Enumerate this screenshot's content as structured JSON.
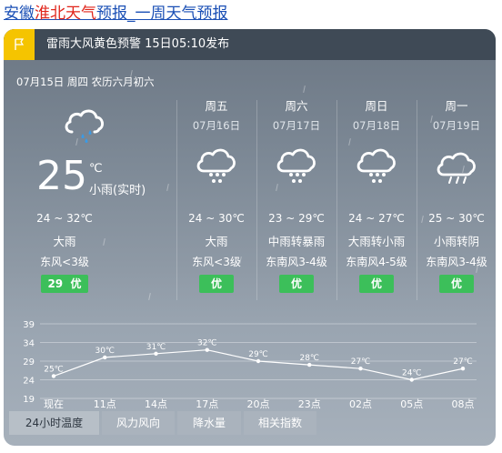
{
  "header": {
    "title_prefix": "安徽",
    "title_red": "淮北天气",
    "title_suffix": "预报_一周天气预报"
  },
  "alert": {
    "text": "雷雨大风黄色预警 15日05:10发布",
    "badge_color": "#f5c400",
    "icon": "warning-flag-icon"
  },
  "today": {
    "date_line": "07月15日 周四 农历六月初六",
    "temp": "25",
    "unit": "℃",
    "realtime_desc": "小雨(实时)",
    "range": "24 ~ 32℃",
    "weather": "大雨",
    "wind": "东风<3级",
    "aqi_value": "29",
    "aqi_label": "优",
    "icon": "light-rain-cloud-icon"
  },
  "forecast": [
    {
      "weekday": "周五",
      "date": "07月16日",
      "range": "24 ~ 30℃",
      "weather": "大雨",
      "wind": "东风<3级",
      "aqi": "优",
      "icon": "rain-cloud-icon"
    },
    {
      "weekday": "周六",
      "date": "07月17日",
      "range": "23 ~ 29℃",
      "weather": "中雨转暴雨",
      "wind": "东南风3-4级",
      "aqi": "优",
      "icon": "rain-cloud-icon"
    },
    {
      "weekday": "周日",
      "date": "07月18日",
      "range": "24 ~ 27℃",
      "weather": "大雨转小雨",
      "wind": "东南风4-5级",
      "aqi": "优",
      "icon": "rain-cloud-icon"
    },
    {
      "weekday": "周一",
      "date": "07月19日",
      "range": "25 ~ 30℃",
      "weather": "小雨转阴",
      "wind": "东南风3-4级",
      "aqi": "优",
      "icon": "cloud-rain-light-icon"
    }
  ],
  "chart_data": {
    "type": "line",
    "categories": [
      "现在",
      "11点",
      "14点",
      "17点",
      "20点",
      "23点",
      "02点",
      "05点",
      "08点"
    ],
    "series": [
      {
        "values": [
          25,
          30,
          31,
          32,
          29,
          28,
          27,
          24,
          27
        ]
      }
    ],
    "point_labels": [
      "25℃",
      "30℃",
      "31℃",
      "32℃",
      "29℃",
      "28℃",
      "27℃",
      "24℃",
      "27℃"
    ],
    "y_ticks": [
      "39",
      "34",
      "29",
      "24",
      "19"
    ],
    "ylim": [
      19,
      39
    ],
    "grid": true,
    "line_color": "#ffffff",
    "aqi_color": "#3cbf5a"
  },
  "tabs": [
    "24小时温度",
    "风力风向",
    "降水量",
    "相关指数"
  ]
}
